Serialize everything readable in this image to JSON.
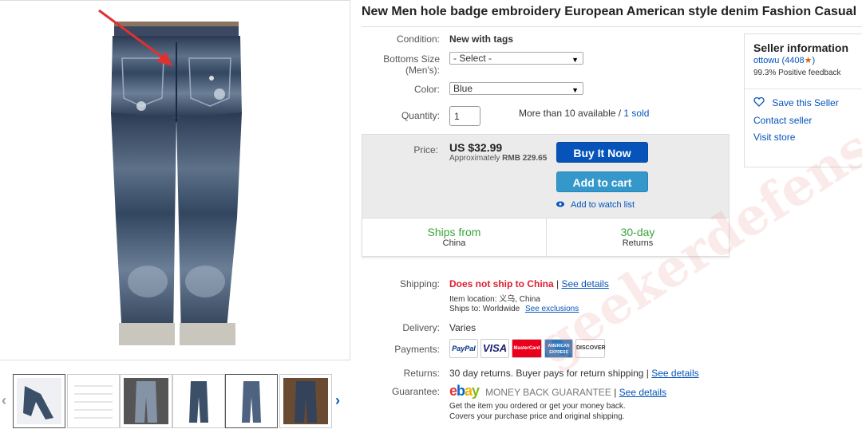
{
  "listing": {
    "title": "New Men hole badge embroidery European American style denim Fashion Casual"
  },
  "details": {
    "condition_label": "Condition:",
    "condition_value": "New with tags",
    "size_label_1": "Bottoms Size",
    "size_label_2": "(Men's):",
    "size_value": "- Select -",
    "color_label": "Color:",
    "color_value": "Blue",
    "quantity_label": "Quantity:",
    "quantity_value": "1",
    "availability": "More than 10 available / ",
    "sold": "1 sold"
  },
  "price": {
    "label": "Price:",
    "amount": "US $32.99",
    "approx_prefix": "Approximately ",
    "approx_value": "RMB 229.65",
    "buy_now": "Buy It Now",
    "add_to_cart": "Add to cart",
    "watch": "Add to watch list"
  },
  "shipping_summary": {
    "from_big": "Ships from",
    "from_small": "China",
    "returns_big": "30-day",
    "returns_small": "Returns"
  },
  "shipping": {
    "label": "Shipping:",
    "status": "Does not ship to China",
    "sep": " | ",
    "see_details": "See details",
    "item_location": "Item location:  义乌, China",
    "ships_to": "Ships to:  Worldwide",
    "see_exclusions": "See exclusions"
  },
  "delivery": {
    "label": "Delivery:",
    "value": "Varies"
  },
  "payments": {
    "label": "Payments:",
    "methods": [
      "PayPal",
      "VISA",
      "MasterCard",
      "AMERICAN EXPRESS",
      "DISCOVER"
    ]
  },
  "returns": {
    "label": "Returns:",
    "value": "30 day returns. Buyer pays for return shipping | ",
    "see_details": "See details"
  },
  "guarantee": {
    "label": "Guarantee:",
    "brand": "ebay",
    "title": "MONEY BACK GUARANTEE",
    "sep": " | ",
    "see_details": "See details",
    "line1": "Get the item you ordered or get your money back.",
    "line2": "Covers your purchase price and original shipping."
  },
  "seller": {
    "heading": "Seller information",
    "name": "ottowu",
    "score": "(4408",
    "score_end": ")",
    "feedback": "99.3% Positive feedback",
    "save": "Save this Seller",
    "contact": "Contact seller",
    "visit": "Visit store"
  },
  "watermark": "geekerdefense",
  "colors": {
    "link": "#0654ba",
    "buy_button": "#0654ba",
    "cart_button": "#3498ca",
    "ship_green": "#3aa43a",
    "error_red": "#dd1e31"
  }
}
